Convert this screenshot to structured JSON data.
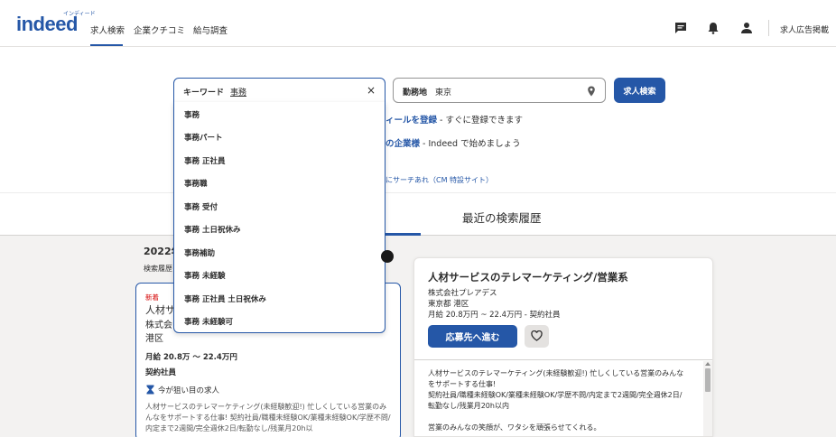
{
  "header": {
    "logo_text": "indeed",
    "logo_kana": "インディード",
    "nav": [
      "求人検索",
      "企業クチコミ",
      "給与調査"
    ],
    "icons": [
      "message-icon",
      "bell-icon",
      "user-icon"
    ],
    "employer_link": "求人広告掲載"
  },
  "search": {
    "keyword_label": "キーワード",
    "keyword_value": "事務",
    "clear_symbol": "×",
    "location_label": "勤務地",
    "location_value": "東京",
    "button_label": "求人検索"
  },
  "promo": {
    "line1_link": "ィールを登録",
    "line1_text": " - すぐに登録できます",
    "line2_link": "の企業様",
    "line2_text": " - Indeed で始めましょう",
    "line3": "にサーチあれ（CM 特設サイト）"
  },
  "suggestions": [
    "事務",
    "事務パート",
    "事務 正社員",
    "事務職",
    "事務 受付",
    "事務 土日祝休み",
    "事務補助",
    "事務 未経験",
    "事務 正社員 土日祝休み",
    "事務 未経験可"
  ],
  "tabs": {
    "recent": "最近の検索履歴"
  },
  "history": {
    "year": "2022年",
    "label": "検索履歴"
  },
  "left_card": {
    "badge": "新着",
    "title": "人材サ",
    "company": "株式会",
    "location": "港区",
    "salary": "月給 20.8万 ～ 22.4万円",
    "type": "契約社員",
    "hot_label": "今が狙い目の求人",
    "description": "人材サービスのテレマーケティング(未経験歓迎!) 忙しくしている営業のみんなをサポートする仕事! 契約社員/職種未経験OK/業種未経験OK/学歴不問/内定まで2週間/完全週休2日/転勤なし/残業月20h以"
  },
  "right_card": {
    "title": "人材サービスのテレマーケティング/営業系",
    "company": "株式会社プレアデス",
    "location": "東京都 港区",
    "salary_type": "月給 20.8万円 ~ 22.4万円 - 契約社員",
    "apply_label": "応募先へ進む",
    "description_lines": [
      "人材サービスのテレマーケティング(未経験歓迎!) 忙しくしている営業のみんな",
      "をサポートする仕事!",
      "契約社員/職種未経験OK/業種未経験OK/学歴不問/内定まで2週間/完全週休2日/",
      "転勤なし/残業月20h以内",
      "",
      "営業のみんなの笑顔が、ワタシを頑張らせてくれる。"
    ]
  },
  "colors": {
    "brand": "#2557a7",
    "new_badge": "#d40000"
  }
}
